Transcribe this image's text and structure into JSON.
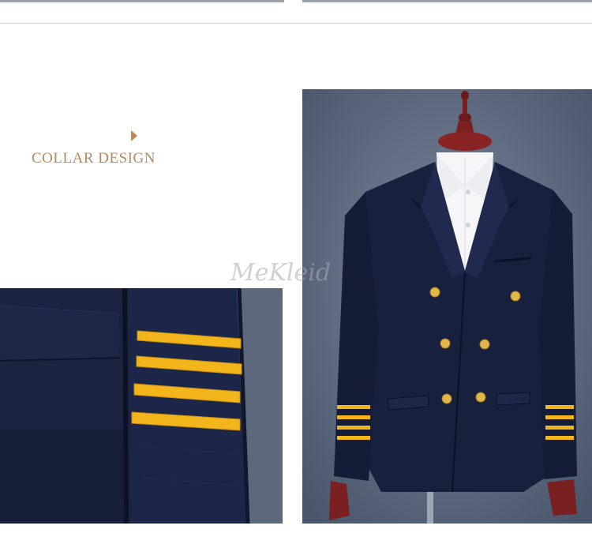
{
  "section": {
    "title": "COLLAR DESIGN",
    "arrow_icon": "caret-right-icon",
    "accent_color": "#b58a5e"
  },
  "watermark": {
    "text": "MeKleid"
  },
  "images": {
    "left": {
      "subject": "sleeve-closeup",
      "stripe_count": 4
    },
    "right": {
      "subject": "jacket-on-mannequin",
      "button_count": 6,
      "sleeve_stripes_each": 4
    }
  },
  "colors": {
    "navy": "#16203a",
    "gold_stripe": "#f2b41c",
    "backdrop": "#5c6a80"
  }
}
